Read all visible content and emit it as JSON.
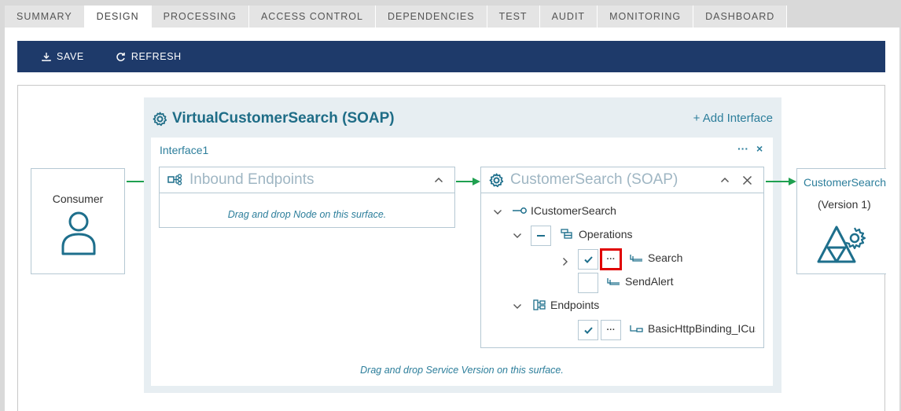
{
  "tabs": [
    "SUMMARY",
    "DESIGN",
    "PROCESSING",
    "ACCESS CONTROL",
    "DEPENDENCIES",
    "TEST",
    "AUDIT",
    "MONITORING",
    "DASHBOARD"
  ],
  "active_tab": "DESIGN",
  "toolbar": {
    "save_label": "SAVE",
    "refresh_label": "REFRESH"
  },
  "group": {
    "title": "VirtualCustomerSearch (SOAP)",
    "add_interface_label": "+ Add Interface",
    "interface_label": "Interface1",
    "more_label": "···",
    "close_label": "×",
    "drop_hint": "Drag and drop Service Version on this surface."
  },
  "consumer": {
    "label": "Consumer"
  },
  "inbound": {
    "title": "Inbound Endpoints",
    "drop_hint": "Drag and drop Node on this surface."
  },
  "service": {
    "title": "CustomerSearch (SOAP)",
    "interface_name": "ICustomerSearch",
    "operations_label": "Operations",
    "operations": [
      "Search",
      "SendAlert"
    ],
    "endpoints_label": "Endpoints",
    "endpoint": "BasicHttpBinding_ICus"
  },
  "target": {
    "label": "CustomerSearch",
    "version": "(Version 1)"
  },
  "colors": {
    "toolbar": "#1e3a6a",
    "accent": "#2c7e9b",
    "arrow": "#1fa050",
    "highlight": "#e00000"
  }
}
